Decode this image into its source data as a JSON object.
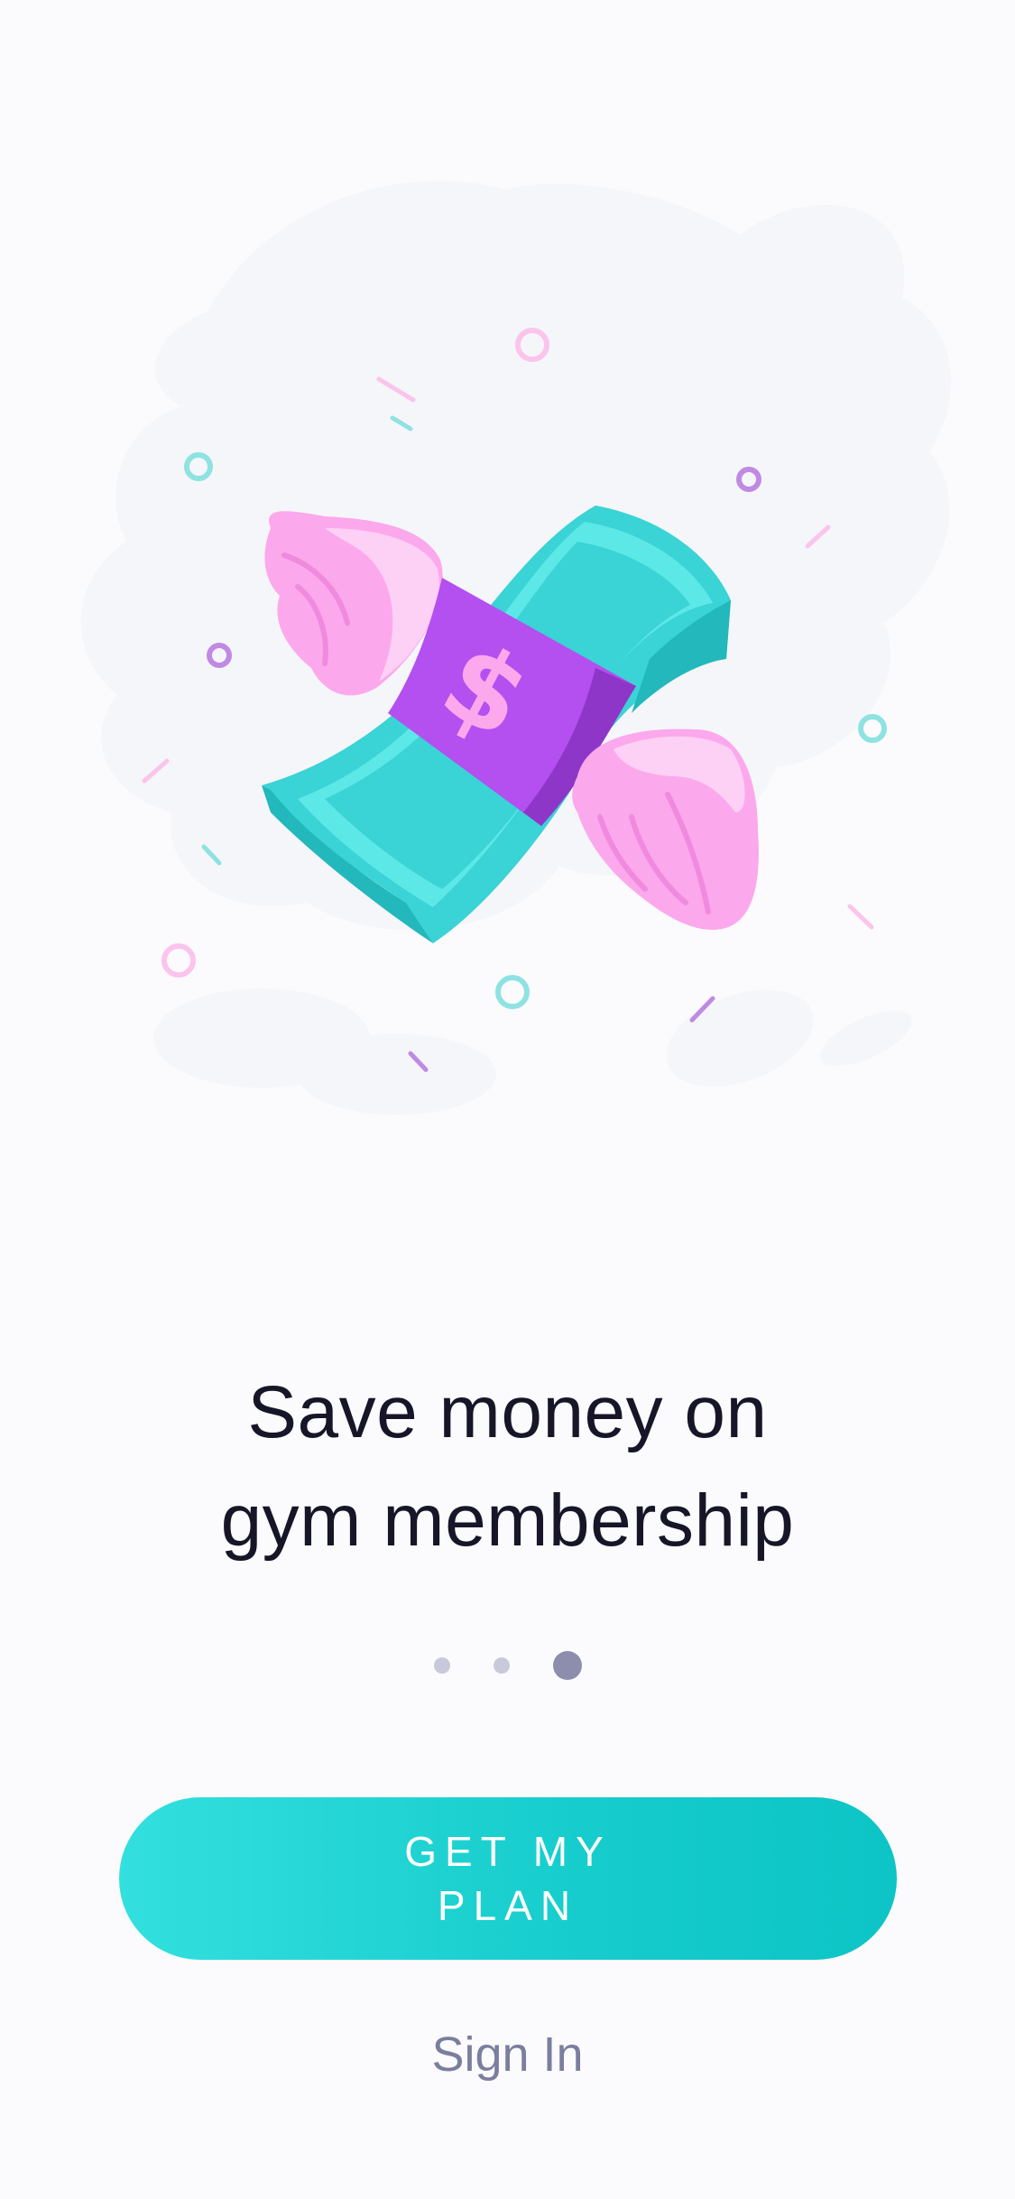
{
  "onboarding": {
    "headline_line1": "Save money on",
    "headline_line2": "gym membership",
    "illustration": "flying-money-with-wings",
    "page_indicator": {
      "total": 3,
      "current": 3
    },
    "primary_button_label": "GET MY PLAN",
    "secondary_link_label": "Sign In",
    "currency_symbol": "$"
  },
  "colors": {
    "background": "#fbfbfd",
    "headline": "#161628",
    "accent_teal": "#16cccc",
    "bill_purple": "#b44ff0",
    "wing_pink": "#fca8ec",
    "dot_inactive": "#c8c9da",
    "dot_active": "#8d8eae",
    "link": "#7b7f9e"
  }
}
